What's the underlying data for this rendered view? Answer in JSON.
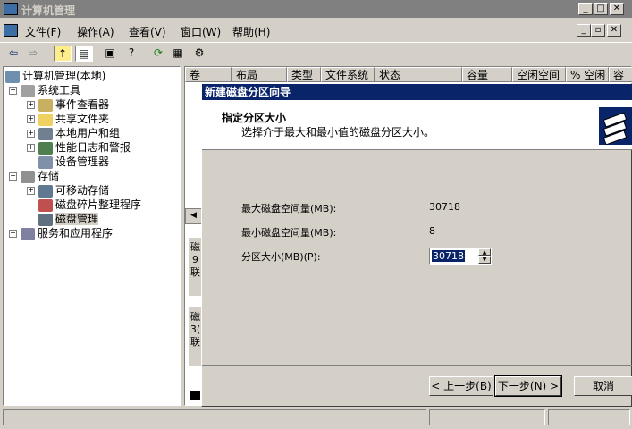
{
  "window": {
    "title": "计算机管理"
  },
  "menu": [
    "文件(F)",
    "操作(A)",
    "查看(V)",
    "窗口(W)",
    "帮助(H)"
  ],
  "tree": {
    "root": "计算机管理(本地)",
    "system_tools": "系统工具",
    "event_viewer": "事件查看器",
    "shared_folders": "共享文件夹",
    "local_users": "本地用户和组",
    "perf_logs": "性能日志和警报",
    "device_manager": "设备管理器",
    "storage": "存储",
    "removable": "可移动存储",
    "defrag": "磁盘碎片整理程序",
    "disk_mgmt": "磁盘管理",
    "services": "服务和应用程序"
  },
  "columns": [
    "卷",
    "布局",
    "类型",
    "文件系统",
    "状态",
    "容量",
    "空闲空间",
    "% 空闲",
    "容"
  ],
  "disk_rows": [
    [
      "磁",
      "9",
      "联"
    ],
    [
      "磁",
      "3(",
      "联"
    ]
  ],
  "dialog": {
    "title": "新建磁盘分区向导",
    "heading": "指定分区大小",
    "subheading": "选择介于最大和最小值的磁盘分区大小。",
    "max_label": "最大磁盘空间量(MB):",
    "max_value": "30718",
    "min_label": "最小磁盘空间量(MB):",
    "min_value": "8",
    "size_label": "分区大小(MB)(P):",
    "size_value": "30718",
    "back_button": "< 上一步(B)",
    "next_button": "下一步(N) >",
    "cancel_button": "取消"
  }
}
